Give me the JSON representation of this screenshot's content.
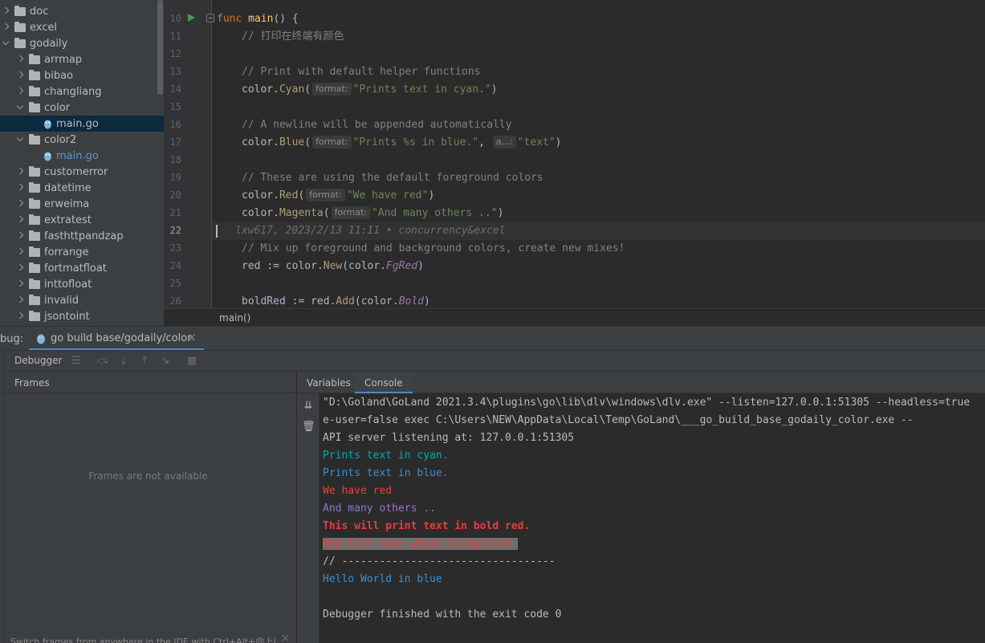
{
  "project_tree": {
    "items": [
      {
        "label": "doc",
        "type": "folder",
        "expanded": false,
        "depth": 0
      },
      {
        "label": "excel",
        "type": "folder",
        "expanded": false,
        "depth": 0
      },
      {
        "label": "godaily",
        "type": "folder",
        "expanded": true,
        "depth": 0
      },
      {
        "label": "arrmap",
        "type": "folder",
        "expanded": false,
        "depth": 1
      },
      {
        "label": "bibao",
        "type": "folder",
        "expanded": false,
        "depth": 1
      },
      {
        "label": "changliang",
        "type": "folder",
        "expanded": false,
        "depth": 1
      },
      {
        "label": "color",
        "type": "folder",
        "expanded": true,
        "depth": 1
      },
      {
        "label": "main.go",
        "type": "gofile",
        "selected": true,
        "depth": 2
      },
      {
        "label": "color2",
        "type": "folder",
        "expanded": true,
        "depth": 1
      },
      {
        "label": "main.go",
        "type": "gofile",
        "selected": false,
        "depth": 2
      },
      {
        "label": "customerror",
        "type": "folder",
        "expanded": false,
        "depth": 1
      },
      {
        "label": "datetime",
        "type": "folder",
        "expanded": false,
        "depth": 1
      },
      {
        "label": "erweima",
        "type": "folder",
        "expanded": false,
        "depth": 1
      },
      {
        "label": "extratest",
        "type": "folder",
        "expanded": false,
        "depth": 1
      },
      {
        "label": "fasthttpandzap",
        "type": "folder",
        "expanded": false,
        "depth": 1
      },
      {
        "label": "forrange",
        "type": "folder",
        "expanded": false,
        "depth": 1
      },
      {
        "label": "fortmatfloat",
        "type": "folder",
        "expanded": false,
        "depth": 1
      },
      {
        "label": "inttofloat",
        "type": "folder",
        "expanded": false,
        "depth": 1
      },
      {
        "label": "invalid",
        "type": "folder",
        "expanded": false,
        "depth": 1
      },
      {
        "label": "jsontoint",
        "type": "folder",
        "expanded": false,
        "depth": 1
      }
    ]
  },
  "editor": {
    "line_numbers": [
      "10",
      "11",
      "12",
      "13",
      "14",
      "15",
      "16",
      "17",
      "18",
      "19",
      "20",
      "21",
      "22",
      "23",
      "24",
      "25",
      "26"
    ],
    "current_line": "22",
    "code": {
      "l10_kw": "func",
      "l10_fn": "main",
      "l10_rest": "() {",
      "l11": "// 打印在终端有颜色",
      "l13": "// Print with default helper functions",
      "l14_pkg": "color.",
      "l14_fn": "Cyan",
      "l14_hint": "format:",
      "l14_str": "\"Prints text in cyan.\"",
      "l16": "// A newline will be appended automatically",
      "l17_pkg": "color.",
      "l17_fn": "Blue",
      "l17_hint": "format:",
      "l17_str": "\"Prints %s in blue.\"",
      "l17_hint2": "a...:",
      "l17_str2": "\"text\"",
      "l19": "// These are using the default foreground colors",
      "l20_pkg": "color.",
      "l20_fn": "Red",
      "l20_hint": "format:",
      "l20_str": "\"We have red\"",
      "l21_pkg": "color.",
      "l21_fn": "Magenta",
      "l21_hint": "format:",
      "l21_str": "\"And many others ..\"",
      "l22_blame": "lxw617, 2023/2/13 11:11 • concurrency&excel",
      "l23": "// Mix up foreground and background colors, create new mixes!",
      "l24_a": "red := color.",
      "l24_fn": "New",
      "l24_b": "(color.",
      "l24_const": "FgRed",
      "l24_c": ")",
      "l26_a": "boldRed := red.",
      "l26_fn": "Add",
      "l26_b": "(color.",
      "l26_const": "Bold",
      "l26_c": ")"
    },
    "breadcrumb": "main()"
  },
  "debug": {
    "label": "bug:",
    "run_tab": "go build base/godaily/color",
    "debugger_tab": "Debugger",
    "frames_header": "Frames",
    "frames_empty": "Frames are not available",
    "frames_hint": "Switch frames from anywhere in the IDE with Ctrl+Alt+向上箭",
    "tabs": [
      "Variables",
      "Console"
    ],
    "active_tab": "Console",
    "console": [
      {
        "text": "\"D:\\Goland\\GoLand 2021.3.4\\plugins\\go\\lib\\dlv\\windows\\dlv.exe\" --listen=127.0.0.1:51305 --headless=true",
        "color": "#bbbbbb"
      },
      {
        "text": "e-user=false exec C:\\Users\\NEW\\AppData\\Local\\Temp\\GoLand\\___go_build_base_godaily_color.exe --",
        "color": "#bbbbbb"
      },
      {
        "text": "API server listening at: 127.0.0.1:51305",
        "color": "#bbbbbb"
      },
      {
        "text": "Prints text in cyan.",
        "color": "#00aaaa"
      },
      {
        "text": "Prints text in blue.",
        "color": "#3d8fd1"
      },
      {
        "text": "We have red",
        "color": "#e0443e"
      },
      {
        "text": "And many others ..",
        "color": "#9876c8"
      },
      {
        "text": "This will print text in bold red.",
        "color": "#f0383f",
        "bold": true
      },
      {
        "text": "Red text with white background.",
        "color": "#ef3b3b",
        "bg": "#6e6e6e"
      },
      {
        "text": "// ----------------------------------",
        "color": "#bbbbbb"
      },
      {
        "text": "Hello World in blue",
        "color": "#3d8fd1"
      },
      {
        "text": "",
        "color": "#bbbbbb"
      },
      {
        "text": "Debugger finished with the exit code 0",
        "color": "#bbbbbb"
      }
    ]
  },
  "icons": {
    "run": "run-gutter-icon",
    "fold": "fold-icon",
    "close": "close-icon",
    "scroll_to_end": "scroll-to-end-icon",
    "trash": "trash-icon"
  }
}
